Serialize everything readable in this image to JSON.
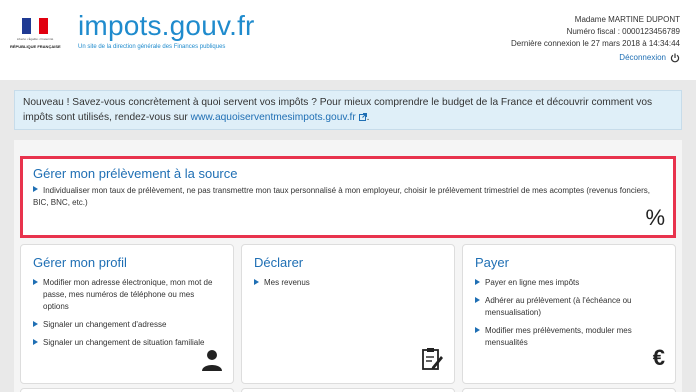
{
  "header": {
    "rf_motto": "Liberté • Égalité • Fraternité",
    "rf_name": "RÉPUBLIQUE FRANÇAISE",
    "brand_title": "impots.gouv.fr",
    "brand_subtitle": "Un site de la direction générale des Finances publiques",
    "user_name": "Madame MARTINE DUPONT",
    "fiscal_number": "Numéro fiscal : 0000123456789",
    "last_login": "Dernière connexion le 27 mars 2018 à 14:34:44",
    "logout_label": "Déconnexion",
    "accent": "#1f8bcd"
  },
  "notice": {
    "text": "Nouveau ! Savez-vous concrètement à quoi servent vos impôts ? Pour mieux comprendre le budget de la France et découvrir comment vos impôts sont utilisés, rendez-vous sur ",
    "link": "www.aquoiserventmesimpots.gouv.fr",
    "end": ".",
    "bg": "#dfeff8"
  },
  "featured": {
    "title": "Gérer mon prélèvement à la source",
    "desc_a": "Individualiser mon taux de prélèvement, ne pas transmettre mon taux personnalisé à mon employeur, choisir le prélèvement trimestriel de mes acomptes (revenus fonciers, ",
    "abbr_bic": "BIC",
    "sep": ", ",
    "abbr_bnc": "BNC",
    "desc_b": ", etc.)",
    "icon_symbol": "%",
    "border_color": "#e8334d"
  },
  "cards": [
    {
      "title": "Gérer mon profil",
      "items": [
        "Modifier mon adresse électronique, mon mot de passe, mes numéros de téléphone ou mes options",
        "Signaler un changement d'adresse",
        "Signaler un changement de situation familiale"
      ],
      "icon": "person-icon"
    },
    {
      "title": "Déclarer",
      "items": [
        "Mes revenus"
      ],
      "icon": "form-edit-icon"
    },
    {
      "title": "Payer",
      "items": [
        "Payer en ligne mes impôts",
        "Adhérer au prélèvement (à l'échéance ou mensualisation)",
        "Modifier mes prélèvements, moduler mes mensualités"
      ],
      "icon": "euro-icon",
      "icon_symbol": "€"
    }
  ]
}
